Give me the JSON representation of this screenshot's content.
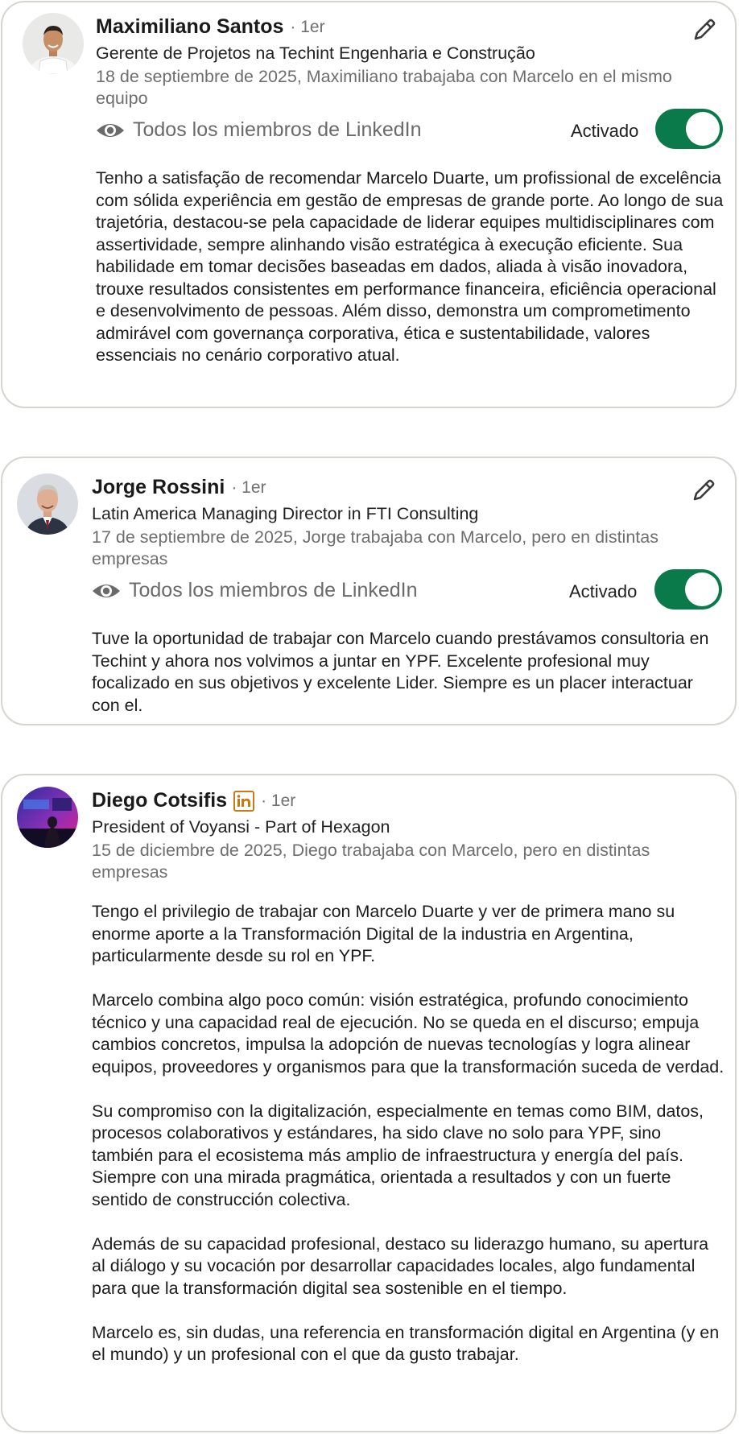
{
  "recommendations": [
    {
      "name": "Maximiliano Santos",
      "degree": "· 1er",
      "headline": "Gerente de Projetos na Techint Engenharia e Construção",
      "meta": "18 de septiembre de 2025, Maximiliano trabajaba con Marcelo en el mismo equipo",
      "visibility": "Todos los miembros de LinkedIn",
      "toggle_label": "Activado",
      "toggle_on": true,
      "body": [
        "Tenho a satisfação de recomendar Marcelo Duarte, um profissional de excelência com sólida experiência em gestão de empresas de grande porte. Ao longo de sua trajetória, destacou-se pela capacidade de liderar equipes multidisciplinares com assertividade, sempre alinhando visão estratégica à execução eficiente. Sua habilidade em tomar decisões baseadas em dados, aliada à visão inovadora, trouxe resultados consistentes em performance financeira, eficiência operacional e desenvolvimento de pessoas. Além disso, demonstra um comprometimento admirável com governança corporativa, ética e sustentabilidade, valores essenciais no cenário corporativo atual."
      ]
    },
    {
      "name": "Jorge Rossini",
      "degree": "· 1er",
      "headline": "Latin America Managing Director in FTI Consulting",
      "meta": "17 de septiembre de 2025, Jorge trabajaba con Marcelo, pero en distintas empresas",
      "visibility": "Todos los miembros de LinkedIn",
      "toggle_label": "Activado",
      "toggle_on": true,
      "body": [
        "Tuve la oportunidad de trabajar con Marcelo cuando prestávamos consultoria en Techint y ahora nos volvimos a juntar en YPF. Excelente profesional muy focalizado en sus objetivos y excelente Lider. Siempre es un placer interactuar con el."
      ]
    },
    {
      "name": "Diego Cotsifis",
      "degree": "· 1er",
      "headline": "President of Voyansi - Part of Hexagon",
      "meta": "15 de diciembre de 2025, Diego trabajaba con Marcelo, pero en distintas empresas",
      "body": [
        "Tengo el privilegio de trabajar con Marcelo Duarte y ver de primera mano su enorme aporte a la Transformación Digital de la industria en Argentina, particularmente desde su rol en YPF.",
        "Marcelo combina algo poco común: visión estratégica, profundo conocimiento técnico y una capacidad real de ejecución. No se queda en el discurso; empuja cambios concretos, impulsa la adopción de nuevas tecnologías y logra alinear equipos, proveedores y organismos para que la transformación suceda de verdad.",
        "Su compromiso con la digitalización, especialmente en temas como BIM, datos, procesos colaborativos y estándares, ha sido clave no solo para YPF, sino también para el ecosistema más amplio de infraestructura y energía del país. Siempre con una mirada pragmática, orientada a resultados y con un fuerte sentido de construcción colectiva.",
        "Además de su capacidad profesional, destaco su liderazgo humano, su apertura al diálogo y su vocación por desarrollar capacidades locales, algo fundamental para que la transformación digital sea sostenible en el tiempo.",
        "Marcelo es, sin dudas, una referencia en transformación digital en Argentina (y en el mundo) y un profesional con el que da gusto trabajar."
      ]
    }
  ],
  "colors": {
    "toggle_on": "#0a7a4a",
    "card_border": "#d8d4cf",
    "badge": "#c37d16"
  },
  "icons": [
    "eye-icon",
    "pencil-icon",
    "linkedin-badge-icon"
  ]
}
